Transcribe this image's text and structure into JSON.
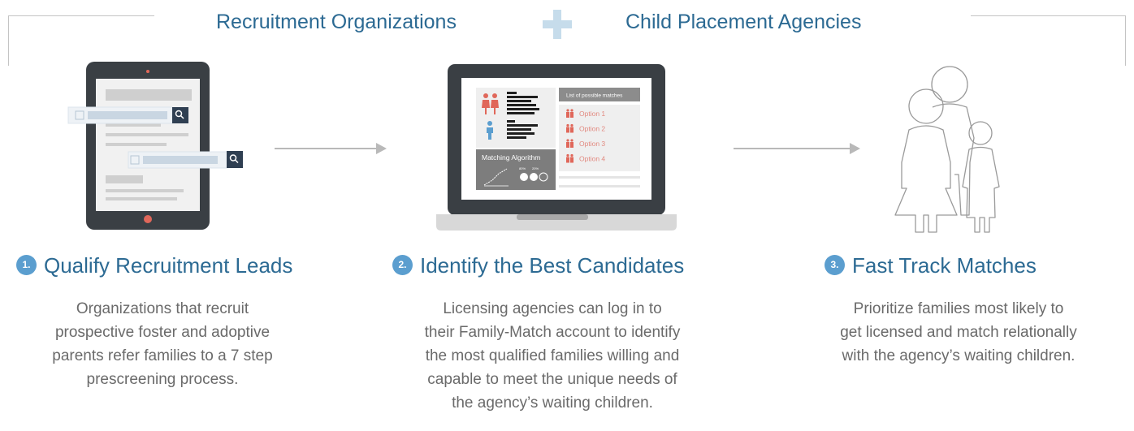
{
  "header": {
    "left_title": "Recruitment Organizations",
    "right_title": "Child Placement Agencies"
  },
  "colors": {
    "accent_blue": "#2c6a93",
    "badge_blue": "#5b9ecf",
    "plus_light_blue": "#c6dceb",
    "body_text": "#6a6a6a",
    "person_red": "#e0675a",
    "person_blue": "#5b9ecf"
  },
  "laptop": {
    "list_header": "List of possible matches",
    "options": [
      "Option 1",
      "Option 2",
      "Option 3",
      "Option 4"
    ],
    "algorithm_label": "Matching Algorithm",
    "pie_labels": [
      "80%",
      "20%"
    ]
  },
  "steps": [
    {
      "number": "1.",
      "title": "Qualify Recruitment Leads",
      "lines": [
        "Organizations that recruit",
        "prospective foster and adoptive",
        "parents refer families to a 7 step",
        "prescreening process."
      ]
    },
    {
      "number": "2.",
      "title": "Identify the Best Candidates",
      "lines": [
        "Licensing agencies can log in to",
        "their Family-Match account to identify",
        "the most qualified families willing and",
        "capable to meet the unique needs of",
        "the agency’s waiting children."
      ]
    },
    {
      "number": "3.",
      "title": "Fast Track Matches",
      "lines": [
        "Prioritize families most likely to",
        "get licensed and match relationally",
        "with the agency’s waiting children."
      ]
    }
  ]
}
